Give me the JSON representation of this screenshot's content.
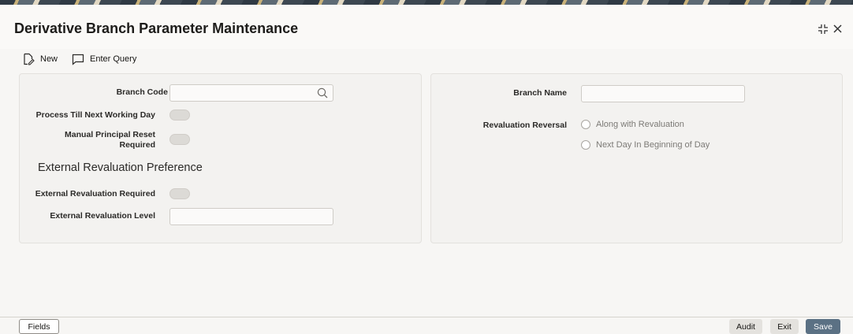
{
  "header": {
    "title": "Derivative Branch Parameter Maintenance"
  },
  "toolbar": {
    "new_label": "New",
    "enter_query_label": "Enter Query"
  },
  "left_panel": {
    "branch_code_label": "Branch Code",
    "branch_code_required": "*",
    "branch_code_value": "",
    "process_till_label": "Process Till Next Working Day",
    "manual_reset_label_line1": "Manual Principal Reset",
    "manual_reset_label_line2": "Required",
    "external_section_title": "External Revaluation Preference",
    "external_required_label": "External Revaluation Required",
    "external_level_label": "External Revaluation Level",
    "external_level_value": ""
  },
  "right_panel": {
    "branch_name_label": "Branch Name",
    "branch_name_value": "",
    "revaluation_reversal_label": "Revaluation Reversal",
    "options": [
      "Along with Revaluation",
      "Next Day In Beginning of Day"
    ]
  },
  "footer": {
    "fields_label": "Fields",
    "audit_label": "Audit",
    "exit_label": "Exit",
    "save_label": "Save"
  },
  "colors": {
    "save_button": "#5b7184",
    "required_marker": "#d63b25"
  }
}
